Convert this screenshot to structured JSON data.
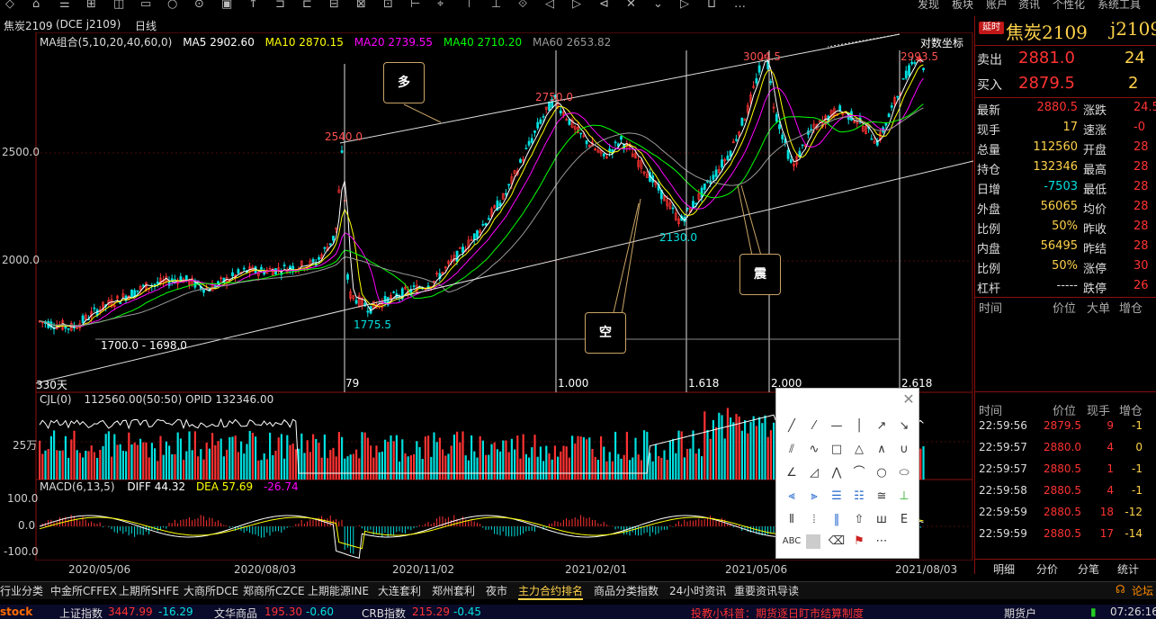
{
  "toolbar": {
    "right_items": [
      "发现",
      "板块",
      "账户",
      "资讯",
      "个性化",
      "系统工具"
    ]
  },
  "title": {
    "symbol": "焦炭2109",
    "code_exchange": "(DCE j2109)",
    "period": "日线"
  },
  "main_legend": {
    "group": "MA组合(5,10,20,40,60,0)",
    "ma5": "MA5 2902.60",
    "ma10": "MA10 2870.15",
    "ma20": "MA20 2739.55",
    "ma40": "MA40 2710.20",
    "ma60": "MA60 2653.82",
    "log_coord": "对数坐标"
  },
  "price_axis": {
    "p2500": "2500.0",
    "p2000": "2000.0"
  },
  "annotations": {
    "h2540": "2540.0",
    "h2750": "2750.0",
    "h3004": "3004.5",
    "h2993": "2993.5",
    "l1775": "1775.5",
    "l2130": "2130.0",
    "range": "1700.0 - 1698.0",
    "days": "330天",
    "n79": "79",
    "fib1": "1.000",
    "fib2": "1.618",
    "fib3": "2.000",
    "fib4": "2.618",
    "duo": "多",
    "kong": "空",
    "zhen": "震"
  },
  "volume_panel": {
    "label": "CJL(0)",
    "values": "112560.00(50:50)  OPID 132346.00",
    "axis": "25万"
  },
  "macd_panel": {
    "label": "MACD(6,13,5)",
    "diff": "DIFF 44.32",
    "dea": "DEA 57.69",
    "macd": "-26.74",
    "axis_top": "100.0",
    "axis_mid": "0.0",
    "axis_bot": "-100.0"
  },
  "date_axis": [
    "2020/05/06",
    "2020/08/03",
    "2020/11/02",
    "2021/02/01",
    "2021/05/06",
    "2021/08/03"
  ],
  "quote": {
    "badge": "延时",
    "name": "焦炭2109",
    "code": "j2109",
    "sell_label": "卖出",
    "sell_price": "2881.0",
    "sell_vol": "24",
    "buy_label": "买入",
    "buy_price": "2879.5",
    "buy_vol": "2",
    "rows": [
      {
        "l1": "最新",
        "v1": "2880.5",
        "l2": "涨跌",
        "v2": "24.5/0"
      },
      {
        "l1": "现手",
        "v1": "17",
        "l2": "速涨",
        "v2": "-0"
      },
      {
        "l1": "总量",
        "v1": "112560",
        "l2": "开盘",
        "v2": "28"
      },
      {
        "l1": "持仓",
        "v1": "132346",
        "l2": "最高",
        "v2": "28"
      },
      {
        "l1": "日增",
        "v1": "-7503",
        "l2": "最低",
        "v2": "28"
      },
      {
        "l1": "外盘",
        "v1": "56065",
        "l2": "均价",
        "v2": "28"
      },
      {
        "l1": "比例",
        "v1": "50%",
        "l2": "昨收",
        "v2": "28"
      },
      {
        "l1": "内盘",
        "v1": "56495",
        "l2": "昨结",
        "v2": "28"
      },
      {
        "l1": "比例",
        "v1": "50%",
        "l2": "涨停",
        "v2": "30"
      },
      {
        "l1": "杠杆",
        "v1": "-----",
        "l2": "跌停",
        "v2": "26"
      }
    ],
    "tick_header": [
      "时间",
      "价位",
      "大单",
      "增仓"
    ],
    "tick_header2": [
      "时间",
      "价位",
      "现手",
      "增仓"
    ],
    "ticks": [
      {
        "t": "22:59:56",
        "p": "2879.5",
        "v": "9",
        "d": "-1"
      },
      {
        "t": "22:59:57",
        "p": "2880.0",
        "v": "4",
        "d": "0"
      },
      {
        "t": "22:59:57",
        "p": "2880.5",
        "v": "1",
        "d": "-1"
      },
      {
        "t": "22:59:58",
        "p": "2880.5",
        "v": "4",
        "d": "-1"
      },
      {
        "t": "22:59:59",
        "p": "2880.5",
        "v": "18",
        "d": "-12"
      },
      {
        "t": "22:59:59",
        "p": "2880.5",
        "v": "17",
        "d": "-14"
      }
    ],
    "bottom_tabs": [
      "明细",
      "分价",
      "分笔",
      "统计"
    ]
  },
  "bottom_tabs": [
    "行业分类",
    "中金所CFFEX",
    "上期所SHFE",
    "大商所DCE",
    "郑商所CZCE",
    "上期能源INE",
    "大连套利",
    "郑州套利",
    "夜市",
    "主力合约排名",
    "商品分类指数",
    "24小时资讯",
    "重要资讯导读"
  ],
  "bottom_right": "论坛",
  "status": {
    "brand": "stock",
    "idx1_name": "上证指数",
    "idx1_val": "3447.99",
    "idx1_chg": "-16.29",
    "idx2_name": "文华商品",
    "idx2_val": "195.30",
    "idx2_chg": "-0.60",
    "idx3_name": "CRB指数",
    "idx3_val": "215.29",
    "idx3_chg": "-0.45",
    "notice": "投教小科普：期货逐日盯市结算制度",
    "account": "期货户",
    "time": "07:26:16"
  },
  "colors": {
    "up": "#ff3232",
    "down": "#00e0e0",
    "ma5": "#ffffff",
    "ma10": "#ffff00",
    "ma20": "#ff00ff",
    "ma40": "#00ff00",
    "ma60": "#999999"
  }
}
